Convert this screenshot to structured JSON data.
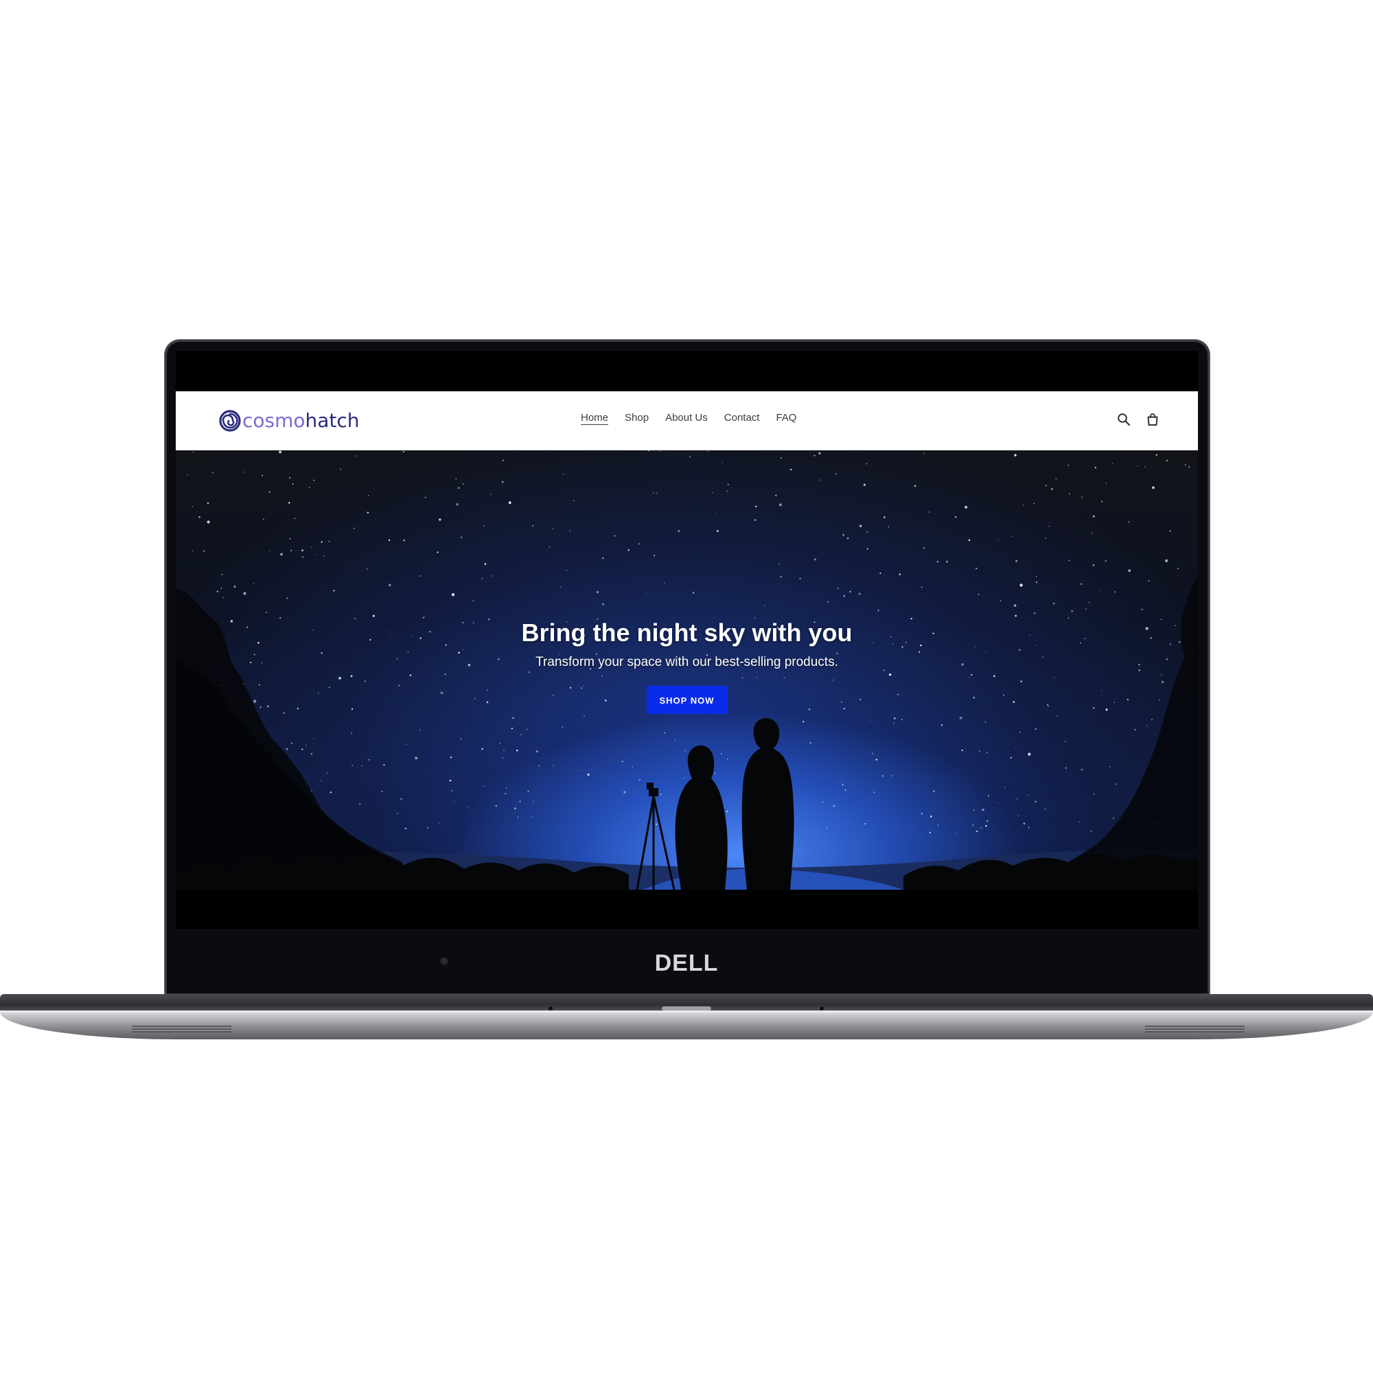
{
  "device": {
    "brand": "DELL"
  },
  "site": {
    "logo": {
      "part_a": "cosmo",
      "part_b": "hatch",
      "icon": "spiral-icon"
    },
    "nav": [
      {
        "label": "Home",
        "active": true
      },
      {
        "label": "Shop",
        "active": false
      },
      {
        "label": "About Us",
        "active": false
      },
      {
        "label": "Contact",
        "active": false
      },
      {
        "label": "FAQ",
        "active": false
      }
    ],
    "header_icons": [
      "search-icon",
      "shopping-bag-icon"
    ]
  },
  "hero": {
    "title": "Bring the night sky with you",
    "subtitle": "Transform your space with our best-selling products.",
    "cta_label": "SHOP NOW"
  },
  "colors": {
    "logo_accent": "#7b6ad6",
    "logo_dark": "#2a2b7c",
    "cta_background": "#0b2bea",
    "header_background": "#ffffff"
  }
}
